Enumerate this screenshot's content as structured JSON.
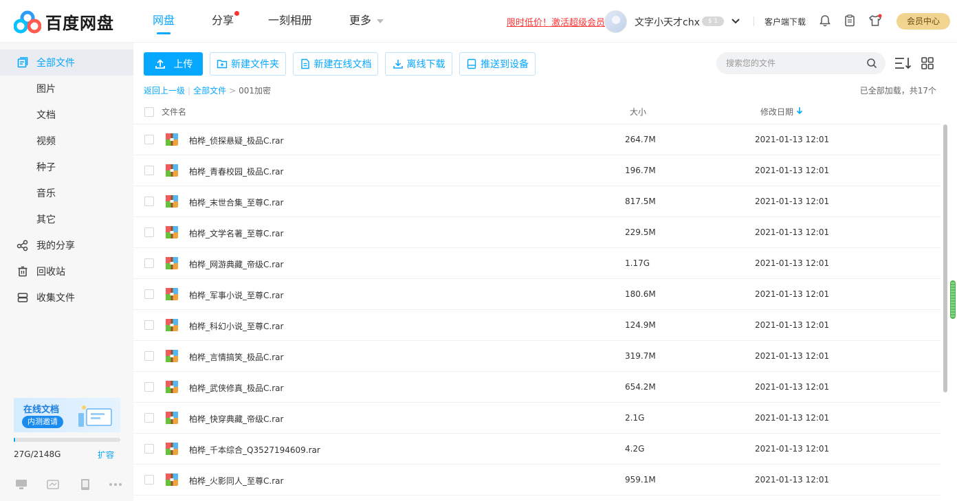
{
  "app": {
    "logo_text": "百度网盘"
  },
  "nav": {
    "items": [
      {
        "label": "网盘",
        "active": true
      },
      {
        "label": "分享",
        "dot": true
      },
      {
        "label": "一刻相册"
      },
      {
        "label": "更多"
      }
    ]
  },
  "header": {
    "promo": "限时低价！激活超级会员",
    "username": "文字小天才chx",
    "vip_badge": "$ 1",
    "client_download": "客户端下载",
    "member_center": "会员中心"
  },
  "sidebar": {
    "items": [
      {
        "label": "全部文件",
        "icon": "folder-icon",
        "active": true
      },
      {
        "label": "图片"
      },
      {
        "label": "文档"
      },
      {
        "label": "视频"
      },
      {
        "label": "种子"
      },
      {
        "label": "音乐"
      },
      {
        "label": "其它"
      },
      {
        "label": "我的分享",
        "icon": "share-icon"
      },
      {
        "label": "回收站",
        "icon": "trash-icon"
      },
      {
        "label": "收集文件",
        "icon": "collect-icon"
      }
    ],
    "promo_title": "在线文档",
    "promo_pill": "内测邀请",
    "quota_text": "27G/2148G",
    "quota_used_fraction": 0.0126,
    "expand": "扩容"
  },
  "toolbar": {
    "upload": "上传",
    "new_folder": "新建文件夹",
    "new_doc": "新建在线文档",
    "offline_download": "离线下载",
    "push_device": "推送到设备",
    "search_placeholder": "搜索您的文件"
  },
  "breadcrumb": {
    "back": "返回上一级",
    "all_files": "全部文件",
    "current": "001加密",
    "loaded_status": "已全部加载，共17个"
  },
  "table": {
    "headers": {
      "name": "文件名",
      "size": "大小",
      "date": "修改日期"
    },
    "rows": [
      {
        "name": "柏桦_侦探悬疑_极品C.rar",
        "size": "264.7M",
        "date": "2021-01-13 12:01"
      },
      {
        "name": "柏桦_青春校园_极品C.rar",
        "size": "196.7M",
        "date": "2021-01-13 12:01"
      },
      {
        "name": "柏桦_末世合集_至尊C.rar",
        "size": "817.5M",
        "date": "2021-01-13 12:01"
      },
      {
        "name": "柏桦_文学名著_至尊C.rar",
        "size": "229.5M",
        "date": "2021-01-13 12:01"
      },
      {
        "name": "柏桦_网游典藏_帝级C.rar",
        "size": "1.17G",
        "date": "2021-01-13 12:01"
      },
      {
        "name": "柏桦_军事小说_至尊C.rar",
        "size": "180.6M",
        "date": "2021-01-13 12:01"
      },
      {
        "name": "柏桦_科幻小说_至尊C.rar",
        "size": "124.9M",
        "date": "2021-01-13 12:01"
      },
      {
        "name": "柏桦_言情搞笑_极品C.rar",
        "size": "319.7M",
        "date": "2021-01-13 12:01"
      },
      {
        "name": "柏桦_武侠修真_极品C.rar",
        "size": "654.2M",
        "date": "2021-01-13 12:01"
      },
      {
        "name": "柏桦_快穿典藏_帝级C.rar",
        "size": "2.1G",
        "date": "2021-01-13 12:01"
      },
      {
        "name": "柏桦_千本综合_Q3527194609.rar",
        "size": "4.2G",
        "date": "2021-01-13 12:01"
      },
      {
        "name": "柏桦_火影同人_至尊C.rar",
        "size": "959.1M",
        "date": "2021-01-13 12:01"
      }
    ]
  },
  "colors": {
    "accent": "#06a7ff",
    "promo_red": "#ff3333",
    "member_gold": "#f1d48f"
  }
}
